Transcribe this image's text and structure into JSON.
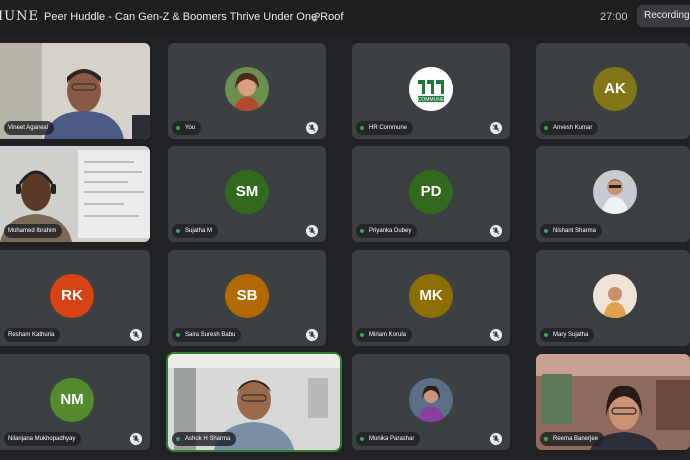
{
  "app": {
    "logo_text": "IUNE",
    "meeting_title": "Peer Huddle - Can Gen-Z & Boomers Thrive Under One Roof",
    "timer": "27:00",
    "recording_label": "Recording"
  },
  "participants": [
    {
      "name": "Vineet Agarwal",
      "type": "video"
    },
    {
      "name": "You",
      "type": "photo"
    },
    {
      "name": "HR Commune",
      "type": "logo",
      "logo_text": "COMMUNE"
    },
    {
      "name": "Anvesh Kumar",
      "type": "initials",
      "initials": "AK",
      "color": "#827717"
    },
    {
      "name": "Mohamed Ibrahim",
      "type": "video"
    },
    {
      "name": "Sujatha M",
      "type": "initials",
      "initials": "SM",
      "color": "#33691e"
    },
    {
      "name": "Priyanka Dubey",
      "type": "initials",
      "initials": "PD",
      "color": "#33691e"
    },
    {
      "name": "Nishant Sharma",
      "type": "photo"
    },
    {
      "name": "Resham Kathuria",
      "type": "initials",
      "initials": "RK",
      "color": "#d84315"
    },
    {
      "name": "Saira Suresh Babu",
      "type": "initials",
      "initials": "SB",
      "color": "#b26a00"
    },
    {
      "name": "Miriam Korula",
      "type": "initials",
      "initials": "MK",
      "color": "#8d6e00"
    },
    {
      "name": "Mary Sujatha",
      "type": "photo"
    },
    {
      "name": "Nilanjana Mukhopadhyay",
      "type": "initials",
      "initials": "NM",
      "color": "#558b2f"
    },
    {
      "name": "Ashok H Sharma",
      "type": "video"
    },
    {
      "name": "Monika Parashar",
      "type": "photo"
    },
    {
      "name": "Reema Banerjee",
      "type": "video"
    }
  ],
  "colors": {
    "background": "#202124",
    "tile": "#3c4043",
    "active_speaker_border": "#2e7d32",
    "speaking_dot": "#34a853"
  }
}
